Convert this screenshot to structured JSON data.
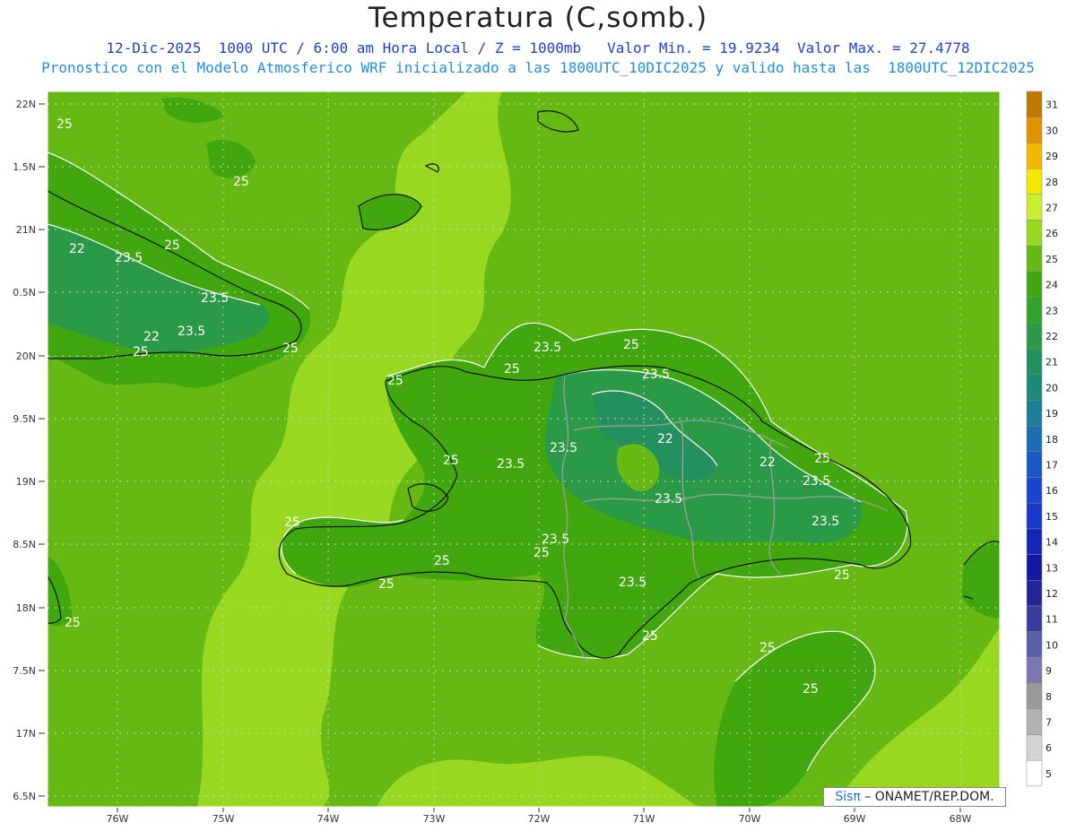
{
  "header": {
    "title": "Temperatura (C,somb.)",
    "subtitle_line1": "12-Dic-2025  1000 UTC / 6:00 am Hora Local / Z = 1000mb   Valor Min. = 19.9234  Valor Max. = 27.4778",
    "subtitle_line2": "Pronostico con el Modelo Atmosferico WRF inicializado a las 1800UTC_10DIC2025 y valido hasta las  1800UTC_12DIC2025"
  },
  "axes": {
    "lat_labels": [
      "22N",
      "1.5N",
      "21N",
      "0.5N",
      "20N",
      "9.5N",
      "19N",
      "8.5N",
      "18N",
      "7.5N",
      "17N",
      "6.5N"
    ],
    "lon_labels": [
      "76W",
      "75W",
      "74W",
      "73W",
      "72W",
      "71W",
      "70W",
      "69W",
      "68W"
    ]
  },
  "colorbar": {
    "labels": [
      "31",
      "30",
      "29",
      "28",
      "27",
      "26",
      "25",
      "24",
      "23",
      "22",
      "21",
      "20",
      "19",
      "18",
      "17",
      "16",
      "15",
      "14",
      "13",
      "12",
      "11",
      "10",
      "9",
      "8",
      "7",
      "6",
      "5"
    ],
    "colors": [
      "#c07800",
      "#e09400",
      "#f5b800",
      "#f5e800",
      "#c8f030",
      "#98d820",
      "#66b812",
      "#40a80e",
      "#30a428",
      "#2a9a46",
      "#23905e",
      "#1c8a78",
      "#1a7e96",
      "#1a6eb4",
      "#1a58c8",
      "#1a44d2",
      "#1838cc",
      "#1426b8",
      "#1218a4",
      "#242498",
      "#383c9c",
      "#5860a8",
      "#7a78b0",
      "#9a9a9a",
      "#b2b2b2",
      "#d4d4d4",
      "#ffffff"
    ]
  },
  "contour_labels": [
    {
      "text": "25"
    },
    {
      "text": "25"
    },
    {
      "text": "25"
    },
    {
      "text": "22"
    },
    {
      "text": "23.5"
    },
    {
      "text": "23.5"
    },
    {
      "text": "23.5"
    },
    {
      "text": "22"
    },
    {
      "text": "25"
    },
    {
      "text": "25"
    },
    {
      "text": "23.5"
    },
    {
      "text": "25"
    },
    {
      "text": "23.5"
    },
    {
      "text": "25"
    },
    {
      "text": "22"
    },
    {
      "text": "25"
    },
    {
      "text": "23.5"
    },
    {
      "text": "23.5"
    },
    {
      "text": "22"
    },
    {
      "text": "25"
    },
    {
      "text": "23.5"
    },
    {
      "text": "23.5"
    },
    {
      "text": "25"
    },
    {
      "text": "23.5"
    },
    {
      "text": "25"
    },
    {
      "text": "25"
    },
    {
      "text": "25"
    },
    {
      "text": "23.5"
    },
    {
      "text": "23.5"
    },
    {
      "text": "25"
    },
    {
      "text": "25"
    },
    {
      "text": "25"
    },
    {
      "text": "25"
    },
    {
      "text": "25"
    },
    {
      "text": "25"
    }
  ],
  "credit": {
    "logo_text": "Sisπ",
    "text": " – ONAMET/REP.DOM."
  },
  "colors": {
    "ocean_light": "#98d820",
    "ocean_mid": "#66b812",
    "land_green": "#40a80e",
    "land_dark": "#2a9a46",
    "coast": "#111111",
    "border": "#a0a0a0",
    "contour": "#ffffff"
  }
}
